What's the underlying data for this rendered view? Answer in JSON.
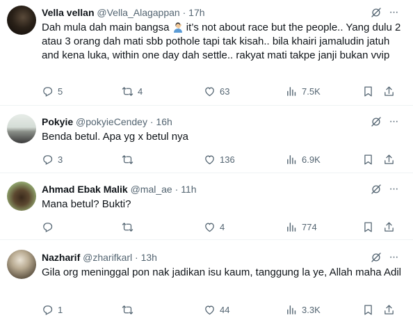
{
  "tweets": [
    {
      "name": "Vella vellan",
      "handle": "@Vella_Alagappan",
      "time": "17h",
      "text_a": "Dah mula dah main bangsa ",
      "emoji": "person-facepalming",
      "text_b": " it’s not about race but the people.. Yang dulu 2 atau 3 orang dah mati sbb pothole tapi tak kisah.. bila khairi jamaludin jatuh and kena luka, within one day dah settle.. rakyat mati takpe janji bukan vvip",
      "replies": "5",
      "reposts": "4",
      "likes": "63",
      "views": "7.5K"
    },
    {
      "name": "Pokyie",
      "handle": "@pokyieCendey",
      "time": "16h",
      "text": "Benda betul. Apa yg x betul nya",
      "replies": "3",
      "reposts": "",
      "likes": "136",
      "views": "6.9K"
    },
    {
      "name": "Ahmad Ebak Malik",
      "handle": "@mal_ae",
      "time": "11h",
      "text": "Mana betul? Bukti?",
      "replies": "",
      "reposts": "",
      "likes": "4",
      "views": "774"
    },
    {
      "name": "Nazharif",
      "handle": "@zharifkarl",
      "time": "13h",
      "text": "Gila org meninggal pon nak jadikan isu kaum, tanggung la ye, Allah maha Adil",
      "replies": "1",
      "reposts": "",
      "likes": "44",
      "views": "3.3K"
    }
  ],
  "separator": "·",
  "colors": {
    "text": "#0f1419",
    "secondary": "#536471",
    "border": "#eff3f4"
  },
  "icons": [
    "reply-icon",
    "repost-icon",
    "like-icon",
    "views-icon",
    "bookmark-icon",
    "share-icon",
    "grok-icon",
    "more-icon"
  ]
}
